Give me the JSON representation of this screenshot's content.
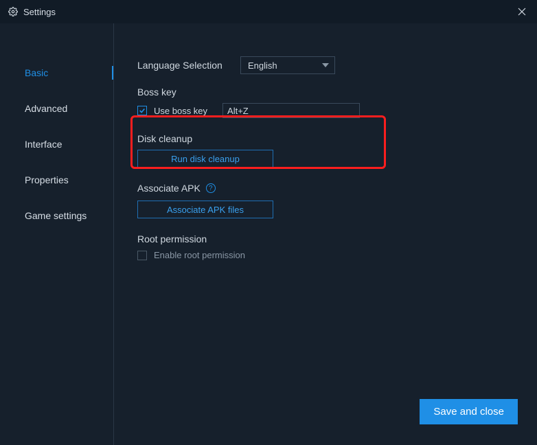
{
  "window": {
    "title": "Settings"
  },
  "sidebar": {
    "items": [
      {
        "label": "Basic",
        "active": true
      },
      {
        "label": "Advanced",
        "active": false
      },
      {
        "label": "Interface",
        "active": false
      },
      {
        "label": "Properties",
        "active": false
      },
      {
        "label": "Game settings",
        "active": false
      }
    ]
  },
  "content": {
    "language": {
      "label": "Language Selection",
      "value": "English"
    },
    "boss_key": {
      "title": "Boss key",
      "checkbox_label": "Use boss key",
      "checked": true,
      "value": "Alt+Z"
    },
    "disk_cleanup": {
      "title": "Disk cleanup",
      "button": "Run disk cleanup"
    },
    "associate_apk": {
      "title": "Associate APK",
      "button": "Associate APK files"
    },
    "root": {
      "title": "Root permission",
      "checkbox_label": "Enable root permission",
      "checked": false
    }
  },
  "footer": {
    "save": "Save and close"
  }
}
